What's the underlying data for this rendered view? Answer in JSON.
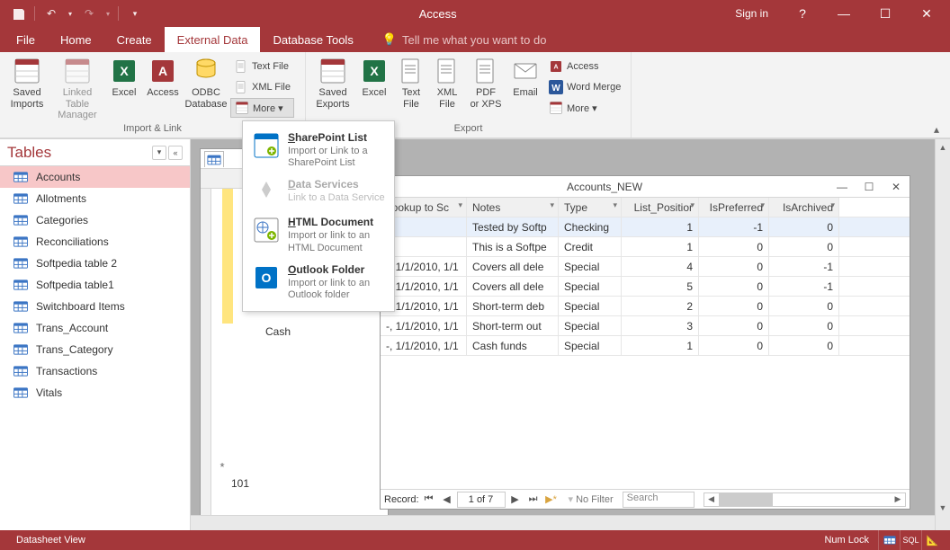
{
  "app": {
    "title": "Access",
    "sign_in": "Sign in"
  },
  "tabs": {
    "file": "File",
    "home": "Home",
    "create": "Create",
    "external_data": "External Data",
    "database_tools": "Database Tools",
    "tellme": "Tell me what you want to do"
  },
  "ribbon": {
    "group_import": "Import & Link",
    "group_export": "Export",
    "saved_imports": "Saved\nImports",
    "linked_table_manager": "Linked Table\nManager",
    "excel": "Excel",
    "access": "Access",
    "odbc": "ODBC\nDatabase",
    "text_file": "Text File",
    "xml_file": "XML File",
    "more": "More ▾",
    "saved_exports": "Saved\nExports",
    "excel2": "Excel",
    "text_file2": "Text\nFile",
    "xml_file2": "XML\nFile",
    "pdf_xps": "PDF\nor XPS",
    "email": "Email",
    "right_access": "Access",
    "right_word": "Word Merge",
    "right_more": "More ▾"
  },
  "dropdown": {
    "sp_title": "SharePoint List",
    "sp_desc": "Import or Link to a SharePoint List",
    "ds_title": "Data Services",
    "ds_desc": "Link to a Data Service",
    "html_title": "HTML Document",
    "html_desc": "Import or link to an HTML Document",
    "ol_title": "Outlook Folder",
    "ol_desc": "Import or link to an Outlook folder"
  },
  "nav": {
    "header": "Tables",
    "items": [
      "Accounts",
      "Allotments",
      "Categories",
      "Reconciliations",
      "Softpedia table 2",
      "Softpedia table1",
      "Switchboard Items",
      "Trans_Account",
      "Trans_Category",
      "Transactions",
      "Vitals"
    ]
  },
  "datasheet": {
    "title": "Accounts_NEW",
    "columns": [
      "Lookup to Sc",
      "Notes",
      "Type",
      "List_Positior",
      "IsPreferred",
      "IsArchived"
    ],
    "col_prefix": "-, 1/1/2010, 1/1",
    "id_col_value": "101",
    "name_col_value": "Cash",
    "rows": [
      {
        "lookup": "",
        "notes": "Tested by Softp",
        "type": "Checking",
        "pos": "1",
        "pref": "-1",
        "arch": "0"
      },
      {
        "lookup": "",
        "notes": "This is a Softpe",
        "type": "Credit",
        "pos": "1",
        "pref": "0",
        "arch": "0"
      },
      {
        "lookup": "-, 1/1/2010, 1/1",
        "notes": "Covers all dele",
        "type": "Special",
        "pos": "4",
        "pref": "0",
        "arch": "-1"
      },
      {
        "lookup": "-, 1/1/2010, 1/1",
        "notes": "Covers all dele",
        "type": "Special",
        "pos": "5",
        "pref": "0",
        "arch": "-1"
      },
      {
        "lookup": "-, 1/1/2010, 1/1",
        "notes": "Short-term deb",
        "type": "Special",
        "pos": "2",
        "pref": "0",
        "arch": "0"
      },
      {
        "lookup": "-, 1/1/2010, 1/1",
        "notes": "Short-term out",
        "type": "Special",
        "pos": "3",
        "pref": "0",
        "arch": "0"
      },
      {
        "lookup": "-, 1/1/2010, 1/1",
        "notes": "Cash funds",
        "type": "Special",
        "pos": "1",
        "pref": "0",
        "arch": "0"
      }
    ],
    "record_label": "Record:",
    "record_pos": "1 of 7",
    "no_filter": "No Filter",
    "search": "Search"
  },
  "status": {
    "view": "Datasheet View",
    "numlock": "Num Lock",
    "sql": "SQL"
  }
}
